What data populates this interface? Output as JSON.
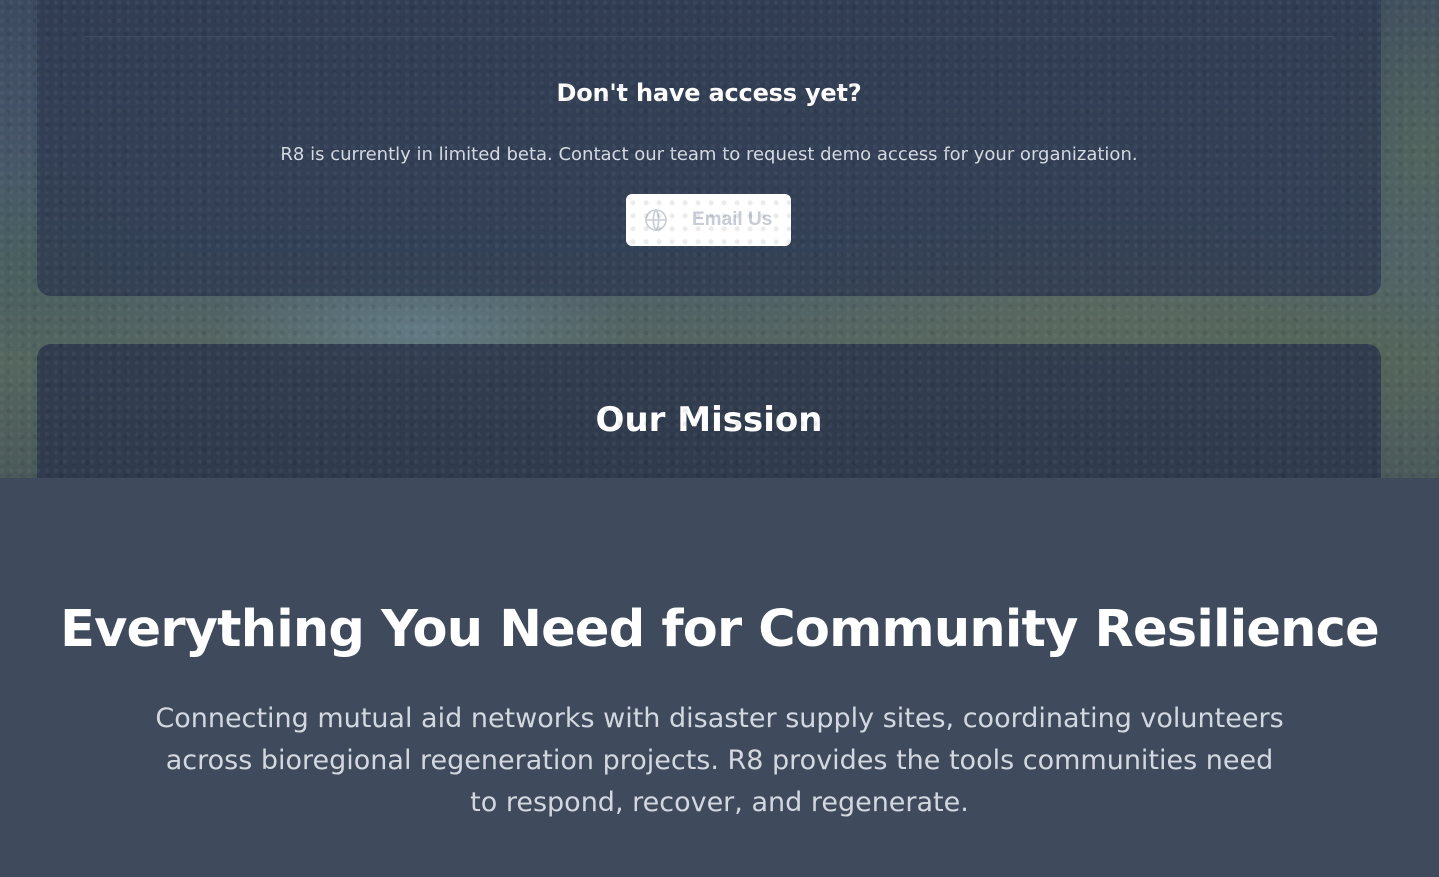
{
  "access_section": {
    "title": "Don't have access yet?",
    "description": "R8 is currently in limited beta. Contact our team to request demo access for your organization.",
    "email_button": {
      "label": "Email Us",
      "icon": "globe-icon"
    }
  },
  "mission_section": {
    "title": "Our Mission"
  },
  "features_section": {
    "title": "Everything You Need for Community Resilience",
    "description": "Connecting mutual aid networks with disaster supply sites, coordinating volunteers across bioregional regeneration projects. R8 provides the tools communities need to respond, recover, and regenerate."
  },
  "colors": {
    "page_background": "#3f4b5d",
    "card_background": "#2e3a50",
    "button_background": "#ffffff",
    "button_text": "#c7ccd6"
  }
}
